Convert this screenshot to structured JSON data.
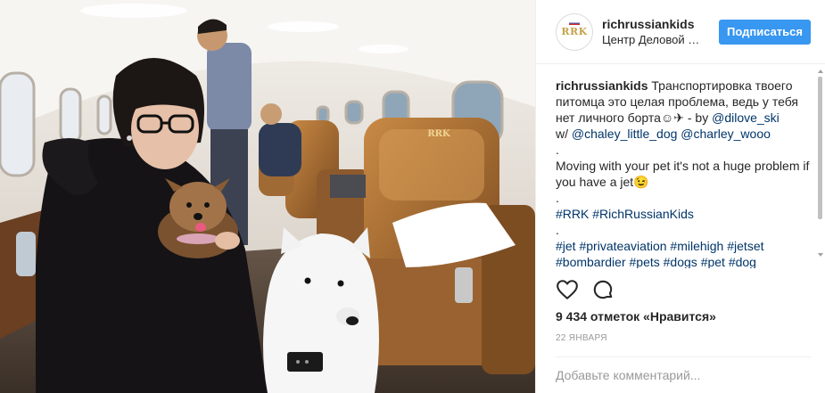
{
  "post": {
    "photo_alt": "Girl with dogs in private jet cabin",
    "seat_logo": "RRK"
  },
  "header": {
    "avatar_text": "RRK",
    "username": "richrussiankids",
    "location": "Центр Деловой …",
    "follow_label": "Подписаться"
  },
  "caption": {
    "username": "richrussiankids",
    "text_ru": " Транспортировка твоего питомца это целая проблема, ведь у тебя нет личного борта☺✈ - by ",
    "mention_1": "@dilove_ski",
    "w_prefix": "w/ ",
    "mention_2": "@chaley_little_dog",
    "mention_3": "@charley_wooo",
    "dot_1": ".",
    "text_en": "Moving with your pet it's not a huge problem if you have a jet😉",
    "dot_2": ".",
    "tag_rrk": "#RRK",
    "tag_rich": "#RichRussianKids",
    "dot_3": ".",
    "tags_line_1": [
      "#jet",
      "#privateaviation",
      "#milehigh",
      "#jetset"
    ],
    "tags_line_2": [
      "#bombardier",
      "#pets",
      "#dogs",
      "#pet",
      "#dog"
    ]
  },
  "actions": {
    "like_icon": "heart-outline-icon",
    "comment_icon": "speech-bubble-icon"
  },
  "stats": {
    "likes": "9 434 отметок «Нравится»",
    "date": "22 ЯНВАРЯ"
  },
  "comment": {
    "placeholder": "Добавьте комментарий..."
  },
  "colors": {
    "accent": "#3897f0",
    "link": "#003569",
    "muted": "#999999"
  }
}
